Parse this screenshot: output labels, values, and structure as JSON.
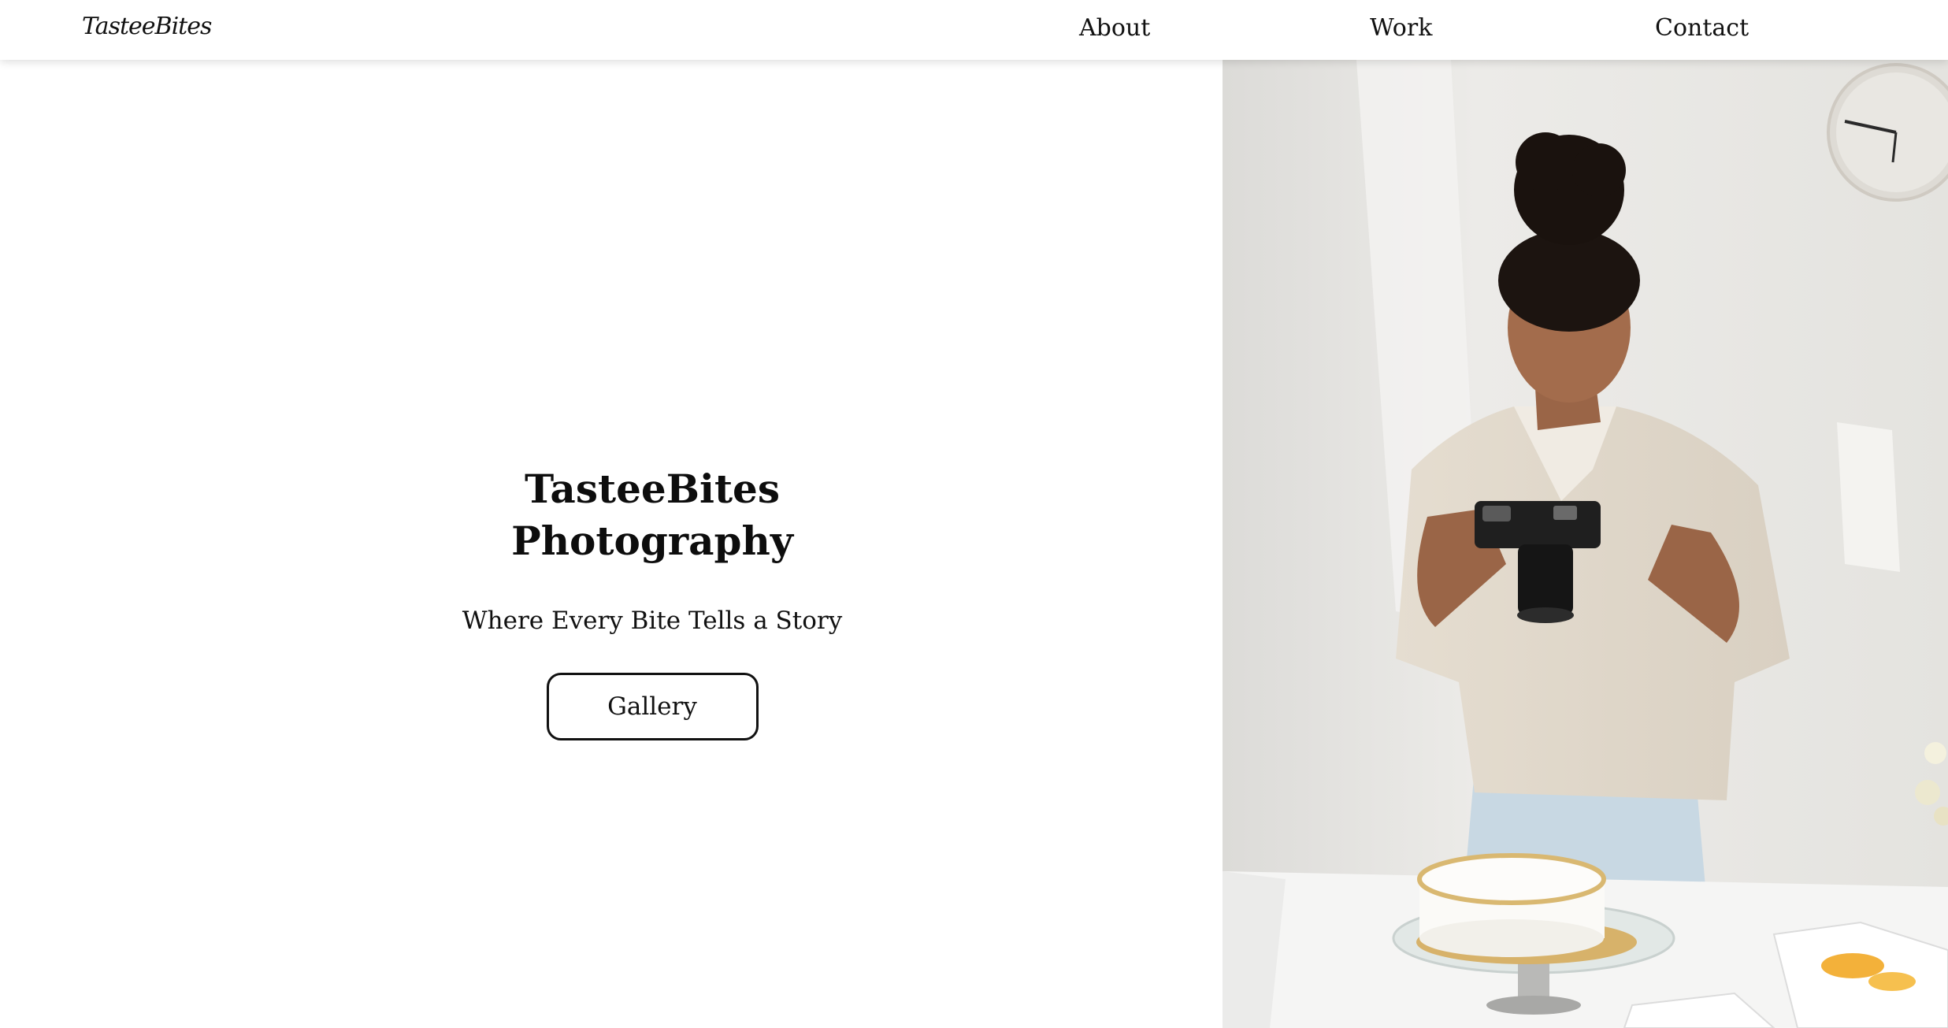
{
  "header": {
    "logo": "TasteeBites",
    "nav": [
      {
        "label": "About"
      },
      {
        "label": "Work"
      },
      {
        "label": "Contact"
      }
    ]
  },
  "hero": {
    "title_line1": "TasteeBites",
    "title_line2": "Photography",
    "subtitle": "Where Every Bite Tells a Story",
    "cta_label": "Gallery"
  },
  "colors": {
    "background": "#ffffff",
    "text": "#111111",
    "photo_wall": "#e7e6e3"
  }
}
